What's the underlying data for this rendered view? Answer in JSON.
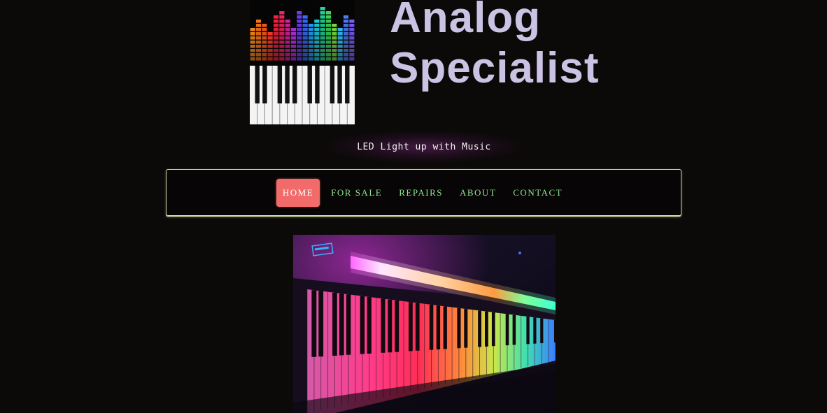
{
  "site": {
    "title_line1": "Analog",
    "title_line2": "Specialist",
    "tagline": "LED Light up with Music",
    "logo_icon": "piano-equalizer-logo"
  },
  "nav": {
    "items": [
      {
        "label": "HOME",
        "active": true
      },
      {
        "label": "FOR SALE",
        "active": false
      },
      {
        "label": "REPAIRS",
        "active": false
      },
      {
        "label": "ABOUT",
        "active": false
      },
      {
        "label": "CONTACT",
        "active": false
      }
    ]
  },
  "hero": {
    "icon": "led-keyboard-photo"
  },
  "colors": {
    "background": "#0c0909",
    "title": "#cbc3e3",
    "nav_text": "#8ee68e",
    "nav_active_bg": "#f26b6b",
    "nav_border": "#c9d5a0"
  }
}
